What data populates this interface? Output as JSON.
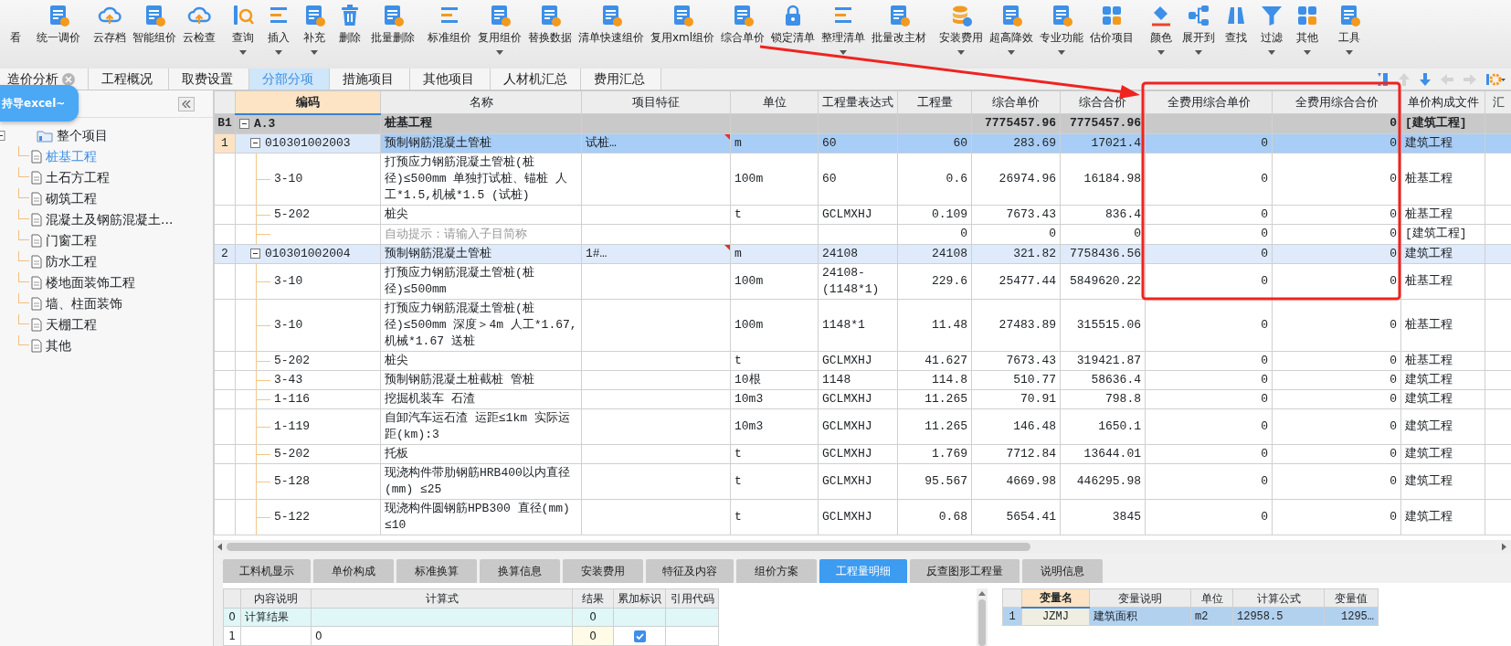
{
  "toolbar": {
    "groups": [
      [
        {
          "label": "看",
          "dropdown": false
        },
        {
          "label": "统一调价",
          "dropdown": false
        }
      ],
      [
        {
          "label": "云存档",
          "dropdown": false
        },
        {
          "label": "智能组价",
          "dropdown": false
        },
        {
          "label": "云检查",
          "dropdown": false
        }
      ],
      [
        {
          "label": "查询",
          "dropdown": true
        },
        {
          "label": "插入",
          "dropdown": true
        },
        {
          "label": "补充",
          "dropdown": true
        },
        {
          "label": "删除",
          "dropdown": false
        },
        {
          "label": "批量删除",
          "dropdown": false
        }
      ],
      [
        {
          "label": "标准组价",
          "dropdown": false
        },
        {
          "label": "复用组价",
          "dropdown": true
        },
        {
          "label": "替换数据",
          "dropdown": false
        },
        {
          "label": "清单快速组价",
          "dropdown": false
        },
        {
          "label": "复用xml组价",
          "dropdown": false
        },
        {
          "label": "综合单价",
          "dropdown": false
        },
        {
          "label": "锁定清单",
          "dropdown": false
        },
        {
          "label": "整理清单",
          "dropdown": true
        },
        {
          "label": "批量改主材",
          "dropdown": false
        }
      ],
      [
        {
          "label": "安装费用",
          "dropdown": true
        },
        {
          "label": "超高降效",
          "dropdown": true
        },
        {
          "label": "专业功能",
          "dropdown": true
        },
        {
          "label": "估价项目",
          "dropdown": false
        }
      ],
      [
        {
          "label": "颜色",
          "dropdown": true
        },
        {
          "label": "展开到",
          "dropdown": true
        },
        {
          "label": "查找",
          "dropdown": false
        },
        {
          "label": "过滤",
          "dropdown": true
        },
        {
          "label": "其他",
          "dropdown": true
        }
      ],
      [
        {
          "label": "工具",
          "dropdown": true
        }
      ]
    ]
  },
  "tabs": [
    {
      "label": "造价分析",
      "selected": false,
      "closable": true
    },
    {
      "label": "工程概况",
      "selected": false,
      "closable": false
    },
    {
      "label": "取费设置",
      "selected": false,
      "closable": false
    },
    {
      "label": "分部分项",
      "selected": true,
      "closable": false
    },
    {
      "label": "措施项目",
      "selected": false,
      "closable": false
    },
    {
      "label": "其他项目",
      "selected": false,
      "closable": false
    },
    {
      "label": "人材机汇总",
      "selected": false,
      "closable": false
    },
    {
      "label": "费用汇总",
      "selected": false,
      "closable": false
    }
  ],
  "sidebar": {
    "bubble": "持导excel~",
    "tree": {
      "label": "整个项目",
      "expanded": true,
      "children": [
        {
          "label": "桩基工程",
          "selected": true
        },
        {
          "label": "土石方工程",
          "selected": false
        },
        {
          "label": "砌筑工程",
          "selected": false
        },
        {
          "label": "混凝土及钢筋混凝土...",
          "selected": false
        },
        {
          "label": "门窗工程",
          "selected": false
        },
        {
          "label": "防水工程",
          "selected": false
        },
        {
          "label": "楼地面装饰工程",
          "selected": false
        },
        {
          "label": "墙、柱面装饰",
          "selected": false
        },
        {
          "label": "天棚工程",
          "selected": false
        },
        {
          "label": "其他",
          "selected": false
        }
      ]
    }
  },
  "table": {
    "columns": [
      {
        "selected": false
      },
      {
        "label": "编码",
        "selected": true
      },
      {
        "label": "名称",
        "selected": false
      },
      {
        "label": "项目特征",
        "selected": false
      },
      {
        "label": "单位",
        "selected": false
      },
      {
        "label": "工程量表达式",
        "selected": false
      },
      {
        "label": "工程量",
        "selected": false
      },
      {
        "label": "综合单价",
        "selected": false
      },
      {
        "label": "综合合价",
        "selected": false
      },
      {
        "label": "全费用综合单价",
        "selected": false
      },
      {
        "label": "全费用综合合价",
        "selected": false
      },
      {
        "label": "单价构成文件",
        "selected": false
      },
      {
        "label": "汇",
        "selected": false
      }
    ],
    "rows": [
      {
        "kind": "section",
        "no": "B1",
        "code": "A.3",
        "name": "桩基工程",
        "price": "7775457.96",
        "total": "7775457.96",
        "full_total": "0",
        "template": "[建筑工程]",
        "selected": false,
        "expanded": true,
        "marked": false
      },
      {
        "kind": "item",
        "no": "1",
        "code": "010301002003",
        "name": "预制钢筋混凝土管桩",
        "feature": "试桩…",
        "unit": "m",
        "expr": "60",
        "qty": "60",
        "price": "283.69",
        "total": "17021.4",
        "full_price": "0",
        "full_total": "0",
        "template": "建筑工程",
        "selected": true,
        "expanded": true,
        "marked": true
      },
      {
        "kind": "sub",
        "code": "3-10",
        "name": "打预应力钢筋混凝土管桩(桩径)≤500mm  单独打试桩、锚桩 人工*1.5,机械*1.5 (试桩)",
        "unit": "100m",
        "expr": "60",
        "qty": "0.6",
        "price": "26974.96",
        "total": "16184.98",
        "full_price": "0",
        "full_total": "0",
        "template": "桩基工程",
        "selected": false,
        "marked": false
      },
      {
        "kind": "sub",
        "code": "5-202",
        "name": "桩尖",
        "unit": "t",
        "expr": "GCLMXHJ",
        "qty": "0.109",
        "price": "7673.43",
        "total": "836.4",
        "full_price": "0",
        "full_total": "0",
        "template": "桩基工程",
        "selected": false,
        "marked": false
      },
      {
        "kind": "hint",
        "name": "自动提示：请输入子目简称",
        "qty": "0",
        "price": "0",
        "total": "0",
        "full_price": "0",
        "full_total": "0",
        "template": "[建筑工程]",
        "selected": false,
        "marked": false
      },
      {
        "kind": "item",
        "no": "2",
        "code": "010301002004",
        "name": "预制钢筋混凝土管桩",
        "feature": "1#…",
        "unit": "m",
        "expr": "24108",
        "qty": "24108",
        "price": "321.82",
        "total": "7758436.56",
        "full_price": "0",
        "full_total": "0",
        "template": "建筑工程",
        "selected": false,
        "expanded": true,
        "marked": true
      },
      {
        "kind": "sub",
        "code": "3-10",
        "name": "打预应力钢筋混凝土管桩(桩径)≤500mm",
        "unit": "100m",
        "expr": "24108-(1148*1)",
        "qty": "229.6",
        "price": "25477.44",
        "total": "5849620.22",
        "full_price": "0",
        "full_total": "0",
        "template": "桩基工程",
        "selected": false,
        "marked": false
      },
      {
        "kind": "sub",
        "code": "3-10",
        "name": "打预应力钢筋混凝土管桩(桩径)≤500mm  深度＞4m 人工*1.67,机械*1.67 送桩",
        "unit": "100m",
        "expr": "1148*1",
        "qty": "11.48",
        "price": "27483.89",
        "total": "315515.06",
        "full_price": "0",
        "full_total": "0",
        "template": "桩基工程",
        "selected": false,
        "marked": false
      },
      {
        "kind": "sub",
        "code": "5-202",
        "name": "桩尖",
        "unit": "t",
        "expr": "GCLMXHJ",
        "qty": "41.627",
        "price": "7673.43",
        "total": "319421.87",
        "full_price": "0",
        "full_total": "0",
        "template": "桩基工程",
        "selected": false,
        "marked": false
      },
      {
        "kind": "sub",
        "code": "3-43",
        "name": "预制钢筋混凝土桩截桩 管桩",
        "unit": "10根",
        "expr": "1148",
        "qty": "114.8",
        "price": "510.77",
        "total": "58636.4",
        "full_price": "0",
        "full_total": "0",
        "template": "建筑工程",
        "selected": false,
        "marked": false
      },
      {
        "kind": "sub",
        "code": "1-116",
        "name": "挖掘机装车 石渣",
        "unit": "10m3",
        "expr": "GCLMXHJ",
        "qty": "11.265",
        "price": "70.91",
        "total": "798.8",
        "full_price": "0",
        "full_total": "0",
        "template": "建筑工程",
        "selected": false,
        "marked": false
      },
      {
        "kind": "sub",
        "code": "1-119",
        "name": "自卸汽车运石渣 运距≤1km  实际运距(km):3",
        "unit": "10m3",
        "expr": "GCLMXHJ",
        "qty": "11.265",
        "price": "146.48",
        "total": "1650.1",
        "full_price": "0",
        "full_total": "0",
        "template": "建筑工程",
        "selected": false,
        "marked": false
      },
      {
        "kind": "sub",
        "code": "5-202",
        "name": "托板",
        "unit": "t",
        "expr": "GCLMXHJ",
        "qty": "1.769",
        "price": "7712.84",
        "total": "13644.01",
        "full_price": "0",
        "full_total": "0",
        "template": "建筑工程",
        "selected": false,
        "marked": false
      },
      {
        "kind": "sub",
        "code": "5-128",
        "name": "现浇构件带肋钢筋HRB400以内直径(mm) ≤25",
        "unit": "t",
        "expr": "GCLMXHJ",
        "qty": "95.567",
        "price": "4669.98",
        "total": "446295.98",
        "full_price": "0",
        "full_total": "0",
        "template": "建筑工程",
        "selected": false,
        "marked": false
      },
      {
        "kind": "sub",
        "code": "5-122",
        "name": "现浇构件圆钢筋HPB300 直径(mm) ≤10",
        "unit": "t",
        "expr": "GCLMXHJ",
        "qty": "0.68",
        "price": "5654.41",
        "total": "3845",
        "full_price": "0",
        "full_total": "0",
        "template": "建筑工程",
        "selected": false,
        "marked": false
      }
    ]
  },
  "bottom_tabs": [
    {
      "label": "工料机显示",
      "selected": false
    },
    {
      "label": "单价构成",
      "selected": false
    },
    {
      "label": "标准换算",
      "selected": false
    },
    {
      "label": "换算信息",
      "selected": false
    },
    {
      "label": "安装费用",
      "selected": false
    },
    {
      "label": "特征及内容",
      "selected": false
    },
    {
      "label": "组价方案",
      "selected": false
    },
    {
      "label": "工程量明细",
      "selected": true
    },
    {
      "label": "反查图形工程量",
      "selected": false
    },
    {
      "label": "说明信息",
      "selected": false
    }
  ],
  "quantity_grid": {
    "columns": [
      "内容说明",
      "计算式",
      "结果",
      "累加标识",
      "引用代码"
    ],
    "rows": [
      {
        "kind": "total",
        "no": "0",
        "desc": "计算结果",
        "result": "0"
      },
      {
        "kind": "entry",
        "no": "1",
        "formula": "0",
        "result": "0",
        "checked": true
      }
    ]
  },
  "variable_grid": {
    "columns": [
      {
        "selected": false
      },
      {
        "label": "变量名",
        "selected": true
      },
      {
        "label": "变量说明",
        "selected": false
      },
      {
        "label": "单位",
        "selected": false
      },
      {
        "label": "计算公式",
        "selected": false
      },
      {
        "label": "变量值",
        "selected": false
      }
    ],
    "rows": [
      {
        "no": "1",
        "name": "JZMJ",
        "desc": "建筑面积",
        "unit": "m2",
        "formula": "12958.5",
        "value": "1295…",
        "selected": true
      }
    ]
  }
}
